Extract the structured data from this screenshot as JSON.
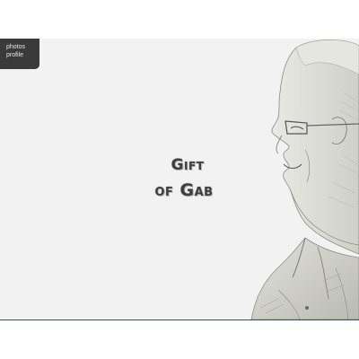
{
  "nav": {
    "items": [
      {
        "label": "photos"
      },
      {
        "label": "profile"
      }
    ]
  },
  "hero": {
    "title_line1": "Gift",
    "title_line2": "of Gab"
  },
  "colors": {
    "background": "#f2f2f2",
    "nav_background": "#3a3a3a",
    "nav_text": "#e6e6e6",
    "title_text": "#3f3f3f",
    "bottom_rule": "#2f5a5a"
  },
  "portrait": {
    "icon": "sketch-portrait-of-man-with-glasses"
  }
}
